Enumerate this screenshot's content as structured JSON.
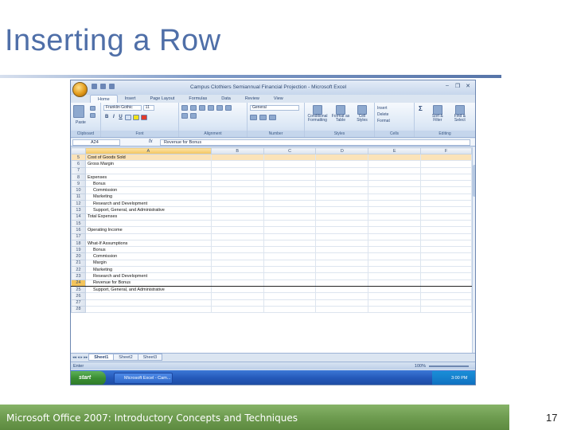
{
  "slide": {
    "title": "Inserting a Row",
    "footer": "Microsoft Office 2007: Introductory Concepts and Techniques",
    "page_number": "17",
    "colors": {
      "title": "#4f6fa8",
      "footer_bar": "#6c9a4e",
      "header_highlight": "#f3c45b"
    }
  },
  "excel": {
    "window_title": "Campus Clothiers Semiannual Financial Projection - Microsoft Excel",
    "window_controls": [
      "–",
      "❐",
      "✕"
    ],
    "tabs": [
      "Home",
      "Insert",
      "Page Layout",
      "Formulas",
      "Data",
      "Review",
      "View"
    ],
    "active_tab": "Home",
    "ribbon": {
      "font_name": "Franklin Gothic",
      "font_size": "11",
      "number_format": "General",
      "group_labels": [
        "Clipboard",
        "Font",
        "Alignment",
        "Number",
        "Styles",
        "Cells",
        "Editing"
      ],
      "paste_label": "Paste",
      "bold": "B",
      "italic": "I",
      "underline": "U",
      "styles_buttons": [
        "Conditional Formatting",
        "Format as Table",
        "Cell Styles"
      ],
      "cells_buttons": [
        "Insert",
        "Delete",
        "Format"
      ],
      "editing_buttons": [
        "Sort & Filter",
        "Find & Select"
      ]
    },
    "name_box": "A24",
    "fx": "fx",
    "formula": "Revenue for Bonus",
    "columns": [
      "A",
      "B",
      "C",
      "D",
      "E",
      "F"
    ],
    "rows": [
      {
        "num": "5",
        "text": "Cost of Goods Sold",
        "indent": false,
        "highlight": true
      },
      {
        "num": "6",
        "text": "Gross Margin",
        "indent": false
      },
      {
        "num": "7",
        "text": "",
        "indent": false
      },
      {
        "num": "8",
        "text": "Expenses",
        "indent": false
      },
      {
        "num": "9",
        "text": "Bonus",
        "indent": true
      },
      {
        "num": "10",
        "text": "Commission",
        "indent": true
      },
      {
        "num": "11",
        "text": "Marketing",
        "indent": true
      },
      {
        "num": "12",
        "text": "Research and Development",
        "indent": true
      },
      {
        "num": "13",
        "text": "Support, General, and Administrative",
        "indent": true
      },
      {
        "num": "14",
        "text": "Total Expenses",
        "indent": false
      },
      {
        "num": "15",
        "text": "",
        "indent": false
      },
      {
        "num": "16",
        "text": "Operating Income",
        "indent": false
      },
      {
        "num": "17",
        "text": "",
        "indent": false
      },
      {
        "num": "18",
        "text": "What-If Assumptions",
        "indent": false
      },
      {
        "num": "19",
        "text": "Bonus",
        "indent": true
      },
      {
        "num": "20",
        "text": "Commission",
        "indent": true
      },
      {
        "num": "21",
        "text": "Margin",
        "indent": true
      },
      {
        "num": "22",
        "text": "Marketing",
        "indent": true
      },
      {
        "num": "23",
        "text": "Research and Development",
        "indent": true
      },
      {
        "num": "24",
        "text": "Revenue for Bonus",
        "indent": true,
        "inserted": true
      },
      {
        "num": "25",
        "text": "Support, General, and Administrative",
        "indent": true
      },
      {
        "num": "26",
        "text": "",
        "indent": false
      },
      {
        "num": "27",
        "text": "",
        "indent": false
      },
      {
        "num": "28",
        "text": "",
        "indent": false
      }
    ],
    "sheet_tabs": [
      "Sheet1",
      "Sheet2",
      "Sheet3"
    ],
    "active_sheet": "Sheet1",
    "status": "Enter",
    "zoom": "100%",
    "taskbar": {
      "start": "start",
      "task": "Microsoft Excel - Cam...",
      "clock": "3:00 PM"
    }
  }
}
